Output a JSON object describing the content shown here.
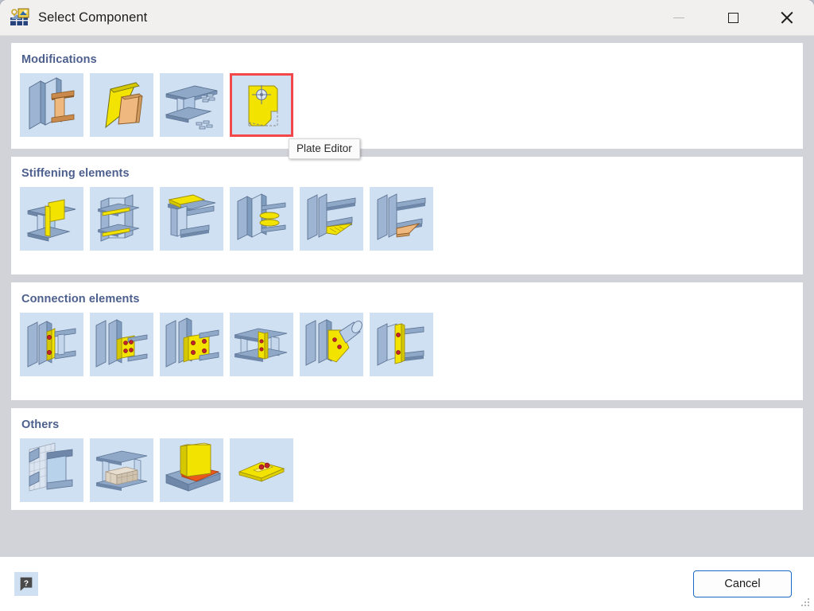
{
  "window": {
    "title": "Select Component",
    "app_icon": "steel-component-icon",
    "controls": {
      "minimize": "minimize-button",
      "maximize": "maximize-button",
      "close": "close-button"
    }
  },
  "tooltip": {
    "visible": true,
    "text": "Plate Editor"
  },
  "colors": {
    "dialog_background": "#d2d3d8",
    "panel_background": "#ffffff",
    "tile_background": "#cfe0f2",
    "heading": "#4c5f8d",
    "selection_border": "#f4474a",
    "focus_border": "#1a69c4",
    "steel_blue": "#8fa8c8",
    "plate_yellow": "#f2e300",
    "bolt_red": "#c3232b",
    "timber_orange": "#e0a070"
  },
  "sections": [
    {
      "id": "modifications",
      "title": "Modifications",
      "items": [
        {
          "id": "mod-1",
          "icon": "web-opening-icon",
          "selected": false
        },
        {
          "id": "mod-2",
          "icon": "plate-folding-icon",
          "selected": false
        },
        {
          "id": "mod-3",
          "icon": "beam-cutout-icon",
          "selected": false
        },
        {
          "id": "mod-4",
          "icon": "plate-editor-icon",
          "selected": true,
          "tooltip": "Plate Editor"
        }
      ]
    },
    {
      "id": "stiffening-elements",
      "title": "Stiffening elements",
      "items": [
        {
          "id": "stf-1",
          "icon": "web-stiffener-icon",
          "selected": false
        },
        {
          "id": "stf-2",
          "icon": "flange-stiffener-icon",
          "selected": false
        },
        {
          "id": "stf-3",
          "icon": "top-plate-stiffener-icon",
          "selected": false
        },
        {
          "id": "stf-4",
          "icon": "ring-stiffener-icon",
          "selected": false
        },
        {
          "id": "stf-5",
          "icon": "haunch-stiffener-icon",
          "selected": false
        },
        {
          "id": "stf-6",
          "icon": "timber-haunch-icon",
          "selected": false
        }
      ]
    },
    {
      "id": "connection-elements",
      "title": "Connection elements",
      "items": [
        {
          "id": "con-1",
          "icon": "end-plate-two-bolt-icon",
          "selected": false
        },
        {
          "id": "con-2",
          "icon": "fin-plate-icon",
          "selected": false
        },
        {
          "id": "con-3",
          "icon": "end-plate-four-bolt-icon",
          "selected": false
        },
        {
          "id": "con-4",
          "icon": "splice-plate-icon",
          "selected": false
        },
        {
          "id": "con-5",
          "icon": "tube-gusset-plate-icon",
          "selected": false
        },
        {
          "id": "con-6",
          "icon": "cleat-angle-icon",
          "selected": false
        }
      ]
    },
    {
      "id": "others",
      "title": "Others",
      "items": [
        {
          "id": "oth-1",
          "icon": "mesh-surface-icon",
          "selected": false
        },
        {
          "id": "oth-2",
          "icon": "mesh-solid-icon",
          "selected": false
        },
        {
          "id": "oth-3",
          "icon": "weld-seam-icon",
          "selected": false
        },
        {
          "id": "oth-4",
          "icon": "base-plate-icon",
          "selected": false
        }
      ]
    }
  ],
  "footer": {
    "help_icon": "help-bubble-icon",
    "cancel_label": "Cancel",
    "resize_grip": "resize-grip-icon"
  }
}
